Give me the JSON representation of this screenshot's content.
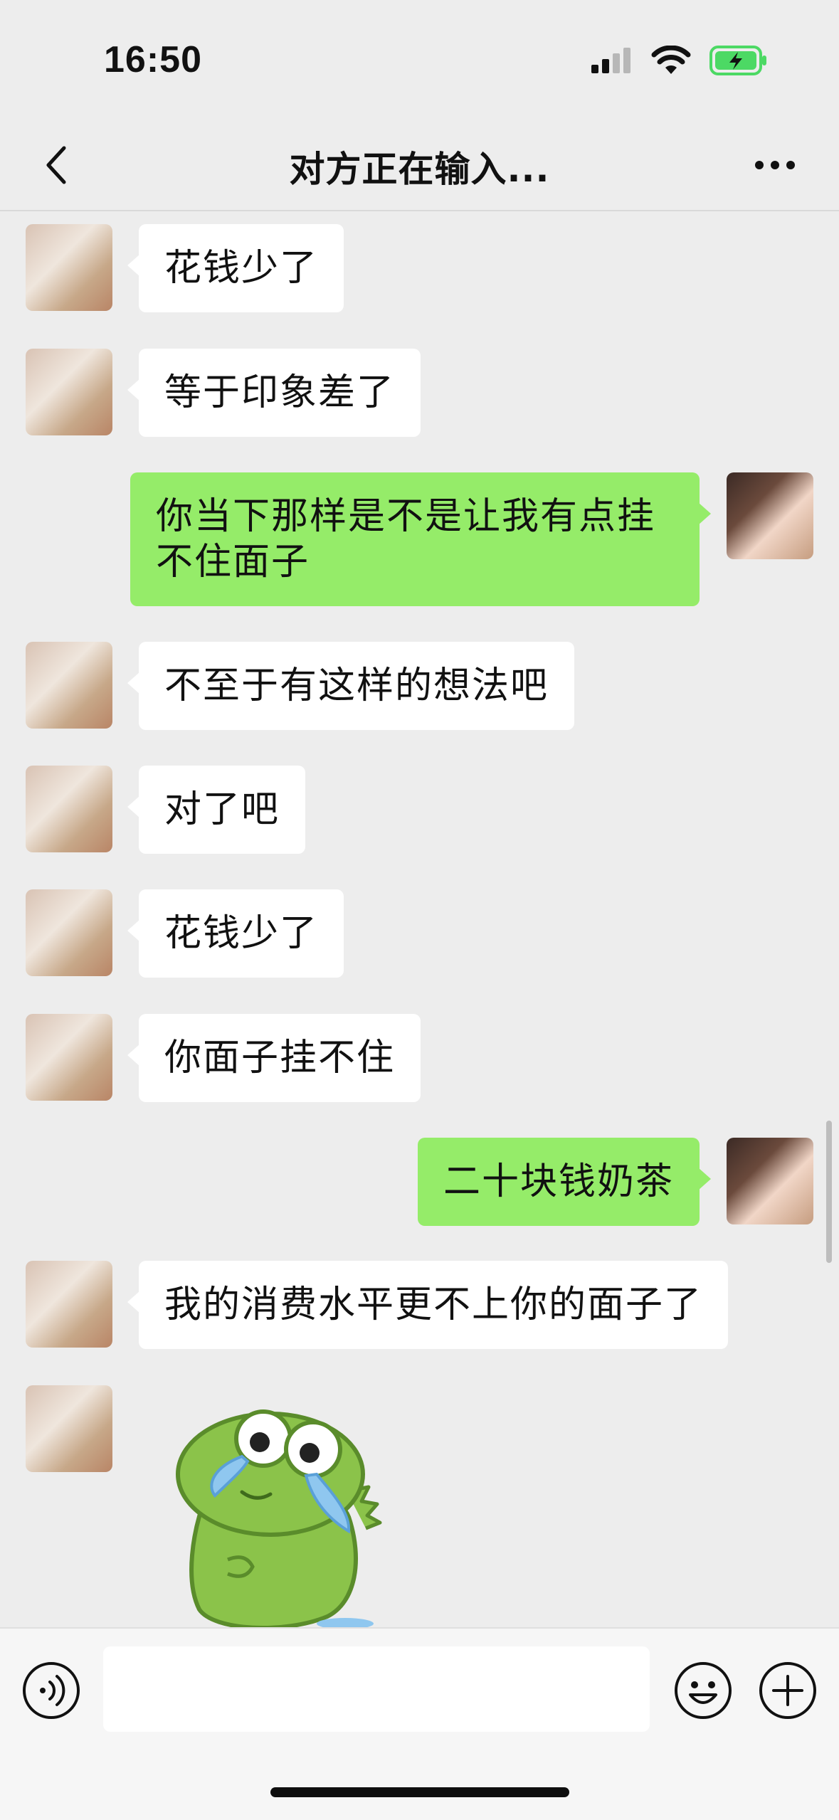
{
  "status_bar": {
    "time": "16:50"
  },
  "nav": {
    "title": "对方正在输入..."
  },
  "messages": [
    {
      "side": "left",
      "text": "花钱少了"
    },
    {
      "side": "left",
      "text": "等于印象差了"
    },
    {
      "side": "right",
      "text": "你当下那样是不是让我有点挂不住面子"
    },
    {
      "side": "left",
      "text": "不至于有这样的想法吧"
    },
    {
      "side": "left",
      "text": "对了吧"
    },
    {
      "side": "left",
      "text": "花钱少了"
    },
    {
      "side": "left",
      "text": "你面子挂不住"
    },
    {
      "side": "right",
      "text": "二十块钱奶茶"
    },
    {
      "side": "left",
      "text": "我的消费水平更不上你的面子了"
    },
    {
      "side": "left",
      "type": "sticker",
      "sticker": "crying-frog-sticker"
    }
  ],
  "input": {
    "value": "",
    "placeholder": ""
  },
  "colors": {
    "background": "#ededed",
    "outgoing_bubble": "#95ec69",
    "incoming_bubble": "#ffffff",
    "battery": "#4cd964"
  },
  "icons": [
    "back-icon",
    "more-icon",
    "voice-icon",
    "emoji-icon",
    "plus-icon",
    "signal-icon",
    "wifi-icon",
    "battery-icon"
  ]
}
